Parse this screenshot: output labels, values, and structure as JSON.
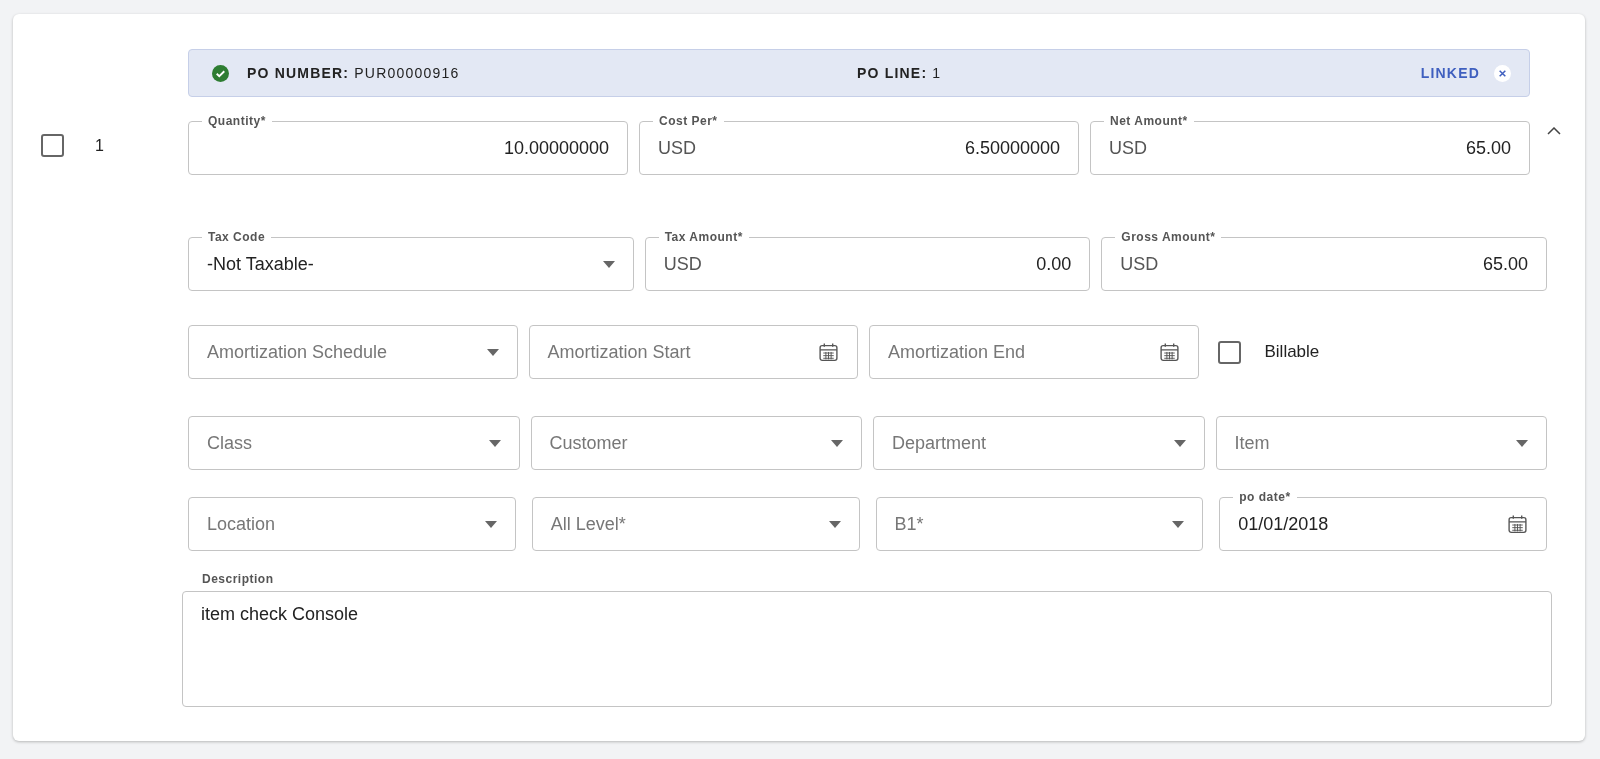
{
  "line": {
    "number": "1",
    "selected": false,
    "expanded": true,
    "banner": {
      "po_number": "**PO NUMBER:** PUR00000916",
      "po_line": "**PO LINE:** 1",
      "status": "LINKED"
    },
    "rows": [
      [
        {
          "kind": "amount",
          "label": "Quantity*",
          "value": "10.00000000"
        },
        {
          "kind": "amount",
          "label": "Cost Per*",
          "prefix": "USD",
          "value": "6.50000000"
        },
        {
          "kind": "amount",
          "label": "Net Amount*",
          "prefix": "USD",
          "value": "65.00"
        }
      ],
      [
        {
          "kind": "select",
          "label": "Tax Code",
          "value": "-Not Taxable-"
        },
        {
          "kind": "amount",
          "label": "Tax Amount*",
          "prefix": "USD",
          "value": "0.00"
        },
        {
          "kind": "amount",
          "label": "Gross Amount*",
          "prefix": "USD",
          "value": "65.00"
        }
      ],
      [
        {
          "kind": "select",
          "placeholder": "Amortization Schedule"
        },
        {
          "kind": "date",
          "placeholder": "Amortization Start"
        },
        {
          "kind": "date",
          "placeholder": "Amortization End"
        },
        {
          "kind": "checkbox",
          "label": "Billable",
          "checked": false
        }
      ],
      [
        {
          "kind": "select",
          "placeholder": "Class"
        },
        {
          "kind": "select",
          "placeholder": "Customer"
        },
        {
          "kind": "select",
          "placeholder": "Department"
        },
        {
          "kind": "select",
          "placeholder": "Item"
        }
      ],
      [
        {
          "kind": "select",
          "placeholder": "Location"
        },
        {
          "kind": "select",
          "placeholder": "All Level*"
        },
        {
          "kind": "select",
          "placeholder": "B1*"
        },
        {
          "kind": "date",
          "label": "po date*",
          "value": "01/01/2018"
        }
      ],
      [
        {
          "kind": "textarea",
          "label": "Description",
          "value": "item check Console"
        }
      ]
    ]
  }
}
